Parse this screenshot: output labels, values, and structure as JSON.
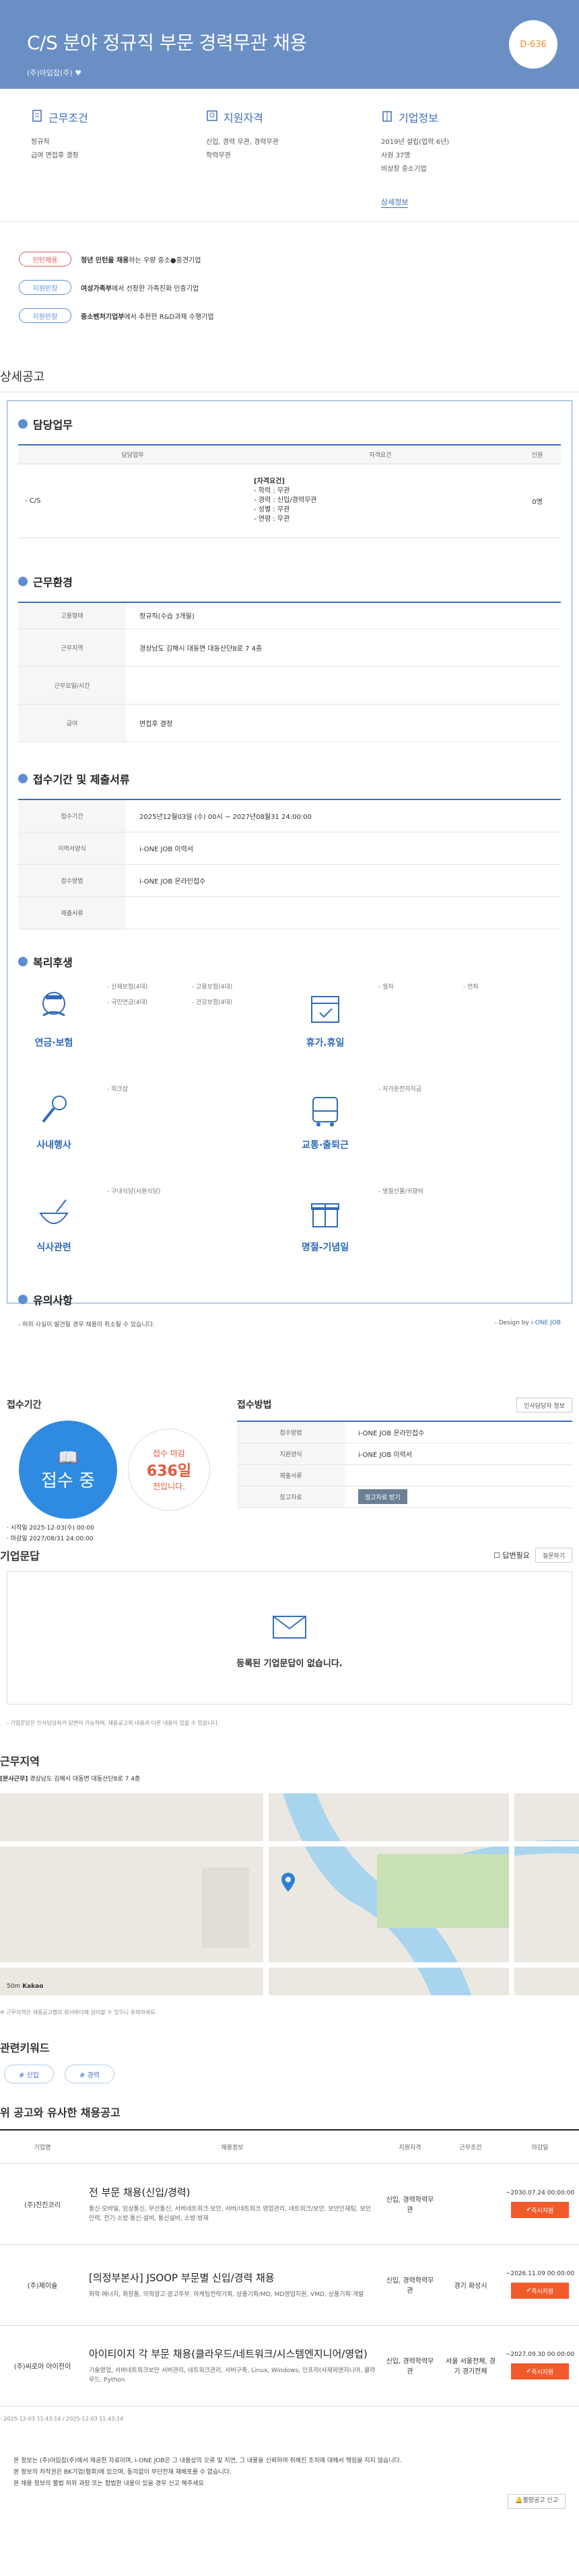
{
  "hero": {
    "title": "C/S 분야 정규직 부문 경력무관 채용",
    "company": "(주)아입잡(주)",
    "dday": "D-636"
  },
  "summary": [
    {
      "title": "근무조건",
      "icon": "document-icon",
      "lines": [
        "정규직",
        "급여 면접후 결정"
      ]
    },
    {
      "title": "지원자격",
      "icon": "person-icon",
      "lines": [
        "신입, 경력 무관, 경력무관",
        "학력무관"
      ]
    },
    {
      "title": "기업정보",
      "icon": "building-icon",
      "lines": [
        "2019년 설립(업력 6년)",
        "사원 37명",
        "비상장 중소기업"
      ],
      "more": "상세정보"
    }
  ],
  "badges": [
    {
      "pill": "인턴채용",
      "text_bold": "청년 인턴을 채용",
      "text": "하는 우량 중소●중견기업"
    },
    {
      "pill": "지원반장",
      "text_bold": "여성가족부",
      "text": "에서 선정한 가족친화 인증기업"
    },
    {
      "pill": "지원반장",
      "text_bold": "중소벤처기업부",
      "text": "에서 추천한 R&D과제 수행기업"
    }
  ],
  "detail": {
    "section_title": "상세공고",
    "duty": {
      "title": "담당업무",
      "headers": [
        "담당업무",
        "자격요건",
        "인원"
      ],
      "row": {
        "duty": "- C/S",
        "req_title": "[자격요건]",
        "reqs": [
          "- 학력 : 무관",
          "- 경력 : 신입/경력무관",
          "- 성별 : 무관",
          "- 연령 : 무관"
        ],
        "count": "0명"
      }
    },
    "env": {
      "title": "근무환경",
      "rows": [
        [
          "고용형태",
          "정규직(수습 3개월)"
        ],
        [
          "근무지역",
          "경상남도 김해시 대동면 대동산단8로 7 4층"
        ],
        [
          "근무요일/시간",
          ""
        ],
        [
          "급여",
          "면접후 결정"
        ]
      ]
    },
    "period": {
      "title": "접수기간 및 제출서류",
      "rows": [
        [
          "접수기간",
          "2025년12월03일 (수) 00시 ~ 2027년08월31 24:00:00"
        ],
        [
          "이력서양식",
          "i-ONE JOB 이력서"
        ],
        [
          "접수방법",
          "i-ONE JOB 온라인접수"
        ],
        [
          "제출서류",
          ""
        ]
      ]
    },
    "welfare": {
      "title": "복리후생",
      "items": [
        {
          "name": "연금·보험",
          "icon": "mustache-icon",
          "tags": [
            "- 산재보험(4대)",
            "- 고용보험(4대)",
            "- 국민연금(4대)",
            "- 건강보험(4대)"
          ]
        },
        {
          "name": "휴가.휴일",
          "icon": "calendar-icon",
          "tags": [
            "- 월차",
            "- 연차"
          ]
        },
        {
          "name": "사내행사",
          "icon": "microphone-icon",
          "tags": [
            "- 워크샵"
          ]
        },
        {
          "name": "교통·출퇴근",
          "icon": "bus-icon",
          "tags": [
            "- 자가운전자지급"
          ]
        },
        {
          "name": "식사관련",
          "icon": "bowl-icon",
          "tags": [
            "- 구내식당(사원식당)"
          ]
        },
        {
          "name": "명절-기념일",
          "icon": "gift-icon",
          "tags": [
            "- 명절선물/귀향비"
          ]
        }
      ]
    },
    "caution": {
      "title": "유의사항",
      "text": "- 허위 사실이 발견될 경우 채용이 취소될 수 있습니다.",
      "design": "- Design by ",
      "design_brand": "i-ONE JOB"
    }
  },
  "apply": {
    "period_title": "접수기간",
    "status": "접수 중",
    "deadline_label": "접수 마감",
    "deadline_days": "636일",
    "deadline_suffix": "전입니다.",
    "start": "· 시작일 2025-12-03(수) 00:00",
    "end": "· 마감일 2027/08/31 24:00:00",
    "method_title": "접수방법",
    "rows": [
      [
        "접수방법",
        "i-ONE JOB 온라인접수"
      ],
      [
        "지원양식",
        "i-ONE JOB 이력서"
      ],
      [
        "제출서류",
        ""
      ],
      [
        "참고자료",
        ""
      ]
    ],
    "attach_btn": "첨고자료 받기",
    "info_btn": "인사담당자 정보"
  },
  "qa": {
    "title": "기업문답",
    "checkbox": "답변필요",
    "select": "질문하기",
    "empty": "등록된 기업문답이 없습니다.",
    "note": "- 기업문답은 인사담당자가 답변이 가능하며, 채용공고의 내용과 다른 내용이 있을 수 있습니다."
  },
  "location": {
    "title": "근무지역",
    "label": "[본사근무]",
    "addr": "경상남도 김해시 대동면 대동산단8로 7 4층",
    "scale": "50m",
    "brand": "Kakao",
    "note": "※ 근무지역은 채용공고별로 회사마다에 상이할 수 있으니 유의하세요."
  },
  "keywords": {
    "title": "관련키워드",
    "items": [
      "# 신입",
      "# 경력"
    ]
  },
  "similar": {
    "title": "위 공고와 유사한 채용공고",
    "headers": [
      "기업명",
      "채용정보",
      "지원자격",
      "근무조건",
      "마감일"
    ],
    "rows": [
      {
        "company": "(주)진진코리",
        "title": "전 부문 채용(신입/경력)",
        "desc": "통신·모바일, 임상통신, 무선통신, 서버네트워크·보안, 서버/네트워크 영업관리, 네트워크/보안, 보안인재팀, 보안인력, 전기·소방·통신·설비, 통신설비, 소방·방재",
        "qual": "신입, 경력학력무관",
        "cond": "",
        "deadline": "~2030.07.24 00:00:00",
        "btn": "즉시지원"
      },
      {
        "company": "(주)제이슐",
        "title": "[의정부본사] JSOOP 부문별 신입/경력 채용",
        "desc": "화학·에너지, 화장품, 의학광고·광고주부, 마케팅전략기획, 상품기획/MD, MD영업지원, VMD, 상품기획·개발",
        "qual": "신입, 경력학력무관",
        "cond": "경기 화성시",
        "deadline": "~2026.11.09 00:00:00",
        "btn": "즉시지원"
      },
      {
        "company": "(주)씨로아 아이전이",
        "title": "아이티이지 각 부문 채용(클라우드/네트워크/시스템엔지니어/영업)",
        "desc": "기술영업, 서버네트워크보안 서버관리, 네트워크관리, 서버구축, Linux, Windows, 인프라(사재외엔지니어, 클라우드, Python",
        "qual": "신입, 경력학력무관",
        "cond": "서울 서울전체, 경기 경기전체",
        "deadline": "~2027.09.30 00:00:00",
        "btn": "즉시지원"
      }
    ],
    "footer": "- 2025-12-03 11:43:14 / 2025-12-03 11:43:14"
  },
  "notice": {
    "lines": [
      "본 정보는 (주)아입잡(주)에서 제공한 자료이며, i-ONE JOB은 그 내용상의 오류 및 지연, 그 내용을 신뢰하여 취해진 조치에 대해서 책임을 지지 않습니다.",
      "본 정보의 저작권은 BK기업(협회)에 있으며, 동의없이 무단전재 재배포를 수 없습니다.",
      "본 채용 정보의 불법 허위 과장 또는 합법한 내용이 있을 경우 신고 해주세요"
    ],
    "report": "불량공고 신고"
  }
}
